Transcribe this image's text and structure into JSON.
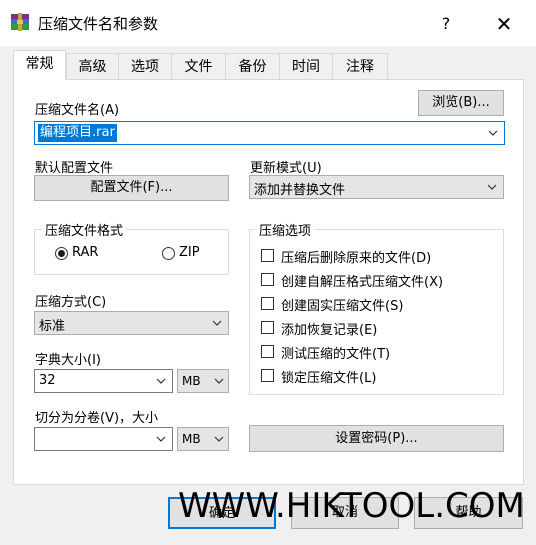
{
  "window": {
    "title": "压缩文件名和参数",
    "help": "?",
    "close": "✕"
  },
  "tabs": [
    "常规",
    "高级",
    "选项",
    "文件",
    "备份",
    "时间",
    "注释"
  ],
  "general": {
    "archive_name_label": "压缩文件名(A)",
    "browse_button": "浏览(B)...",
    "archive_name_value": "编程项目.rar",
    "default_profile_label": "默认配置文件",
    "profile_button": "配置文件(F)...",
    "update_mode_label": "更新模式(U)",
    "update_mode_value": "添加并替换文件",
    "format_group_title": "压缩文件格式",
    "format_rar": "RAR",
    "format_zip": "ZIP",
    "format_selected": "RAR",
    "method_label": "压缩方式(C)",
    "method_value": "标准",
    "dict_label": "字典大小(I)",
    "dict_value": "32",
    "dict_unit": "MB",
    "split_label": "切分为分卷(V)，大小",
    "split_value": "",
    "split_unit": "MB",
    "options_group_title": "压缩选项",
    "options": [
      {
        "label": "压缩后删除原来的文件(D)",
        "checked": false
      },
      {
        "label": "创建自解压格式压缩文件(X)",
        "checked": false
      },
      {
        "label": "创建固实压缩文件(S)",
        "checked": false
      },
      {
        "label": "添加恢复记录(E)",
        "checked": false
      },
      {
        "label": "测试压缩的文件(T)",
        "checked": false
      },
      {
        "label": "锁定压缩文件(L)",
        "checked": false
      }
    ],
    "password_button": "设置密码(P)..."
  },
  "footer": {
    "ok": "确定",
    "cancel": "取消",
    "help": "帮助"
  },
  "watermark": "WWW.HIKTOOL.COM",
  "colors": {
    "selection": "#0078d7",
    "accent_border": "#0078d7"
  }
}
